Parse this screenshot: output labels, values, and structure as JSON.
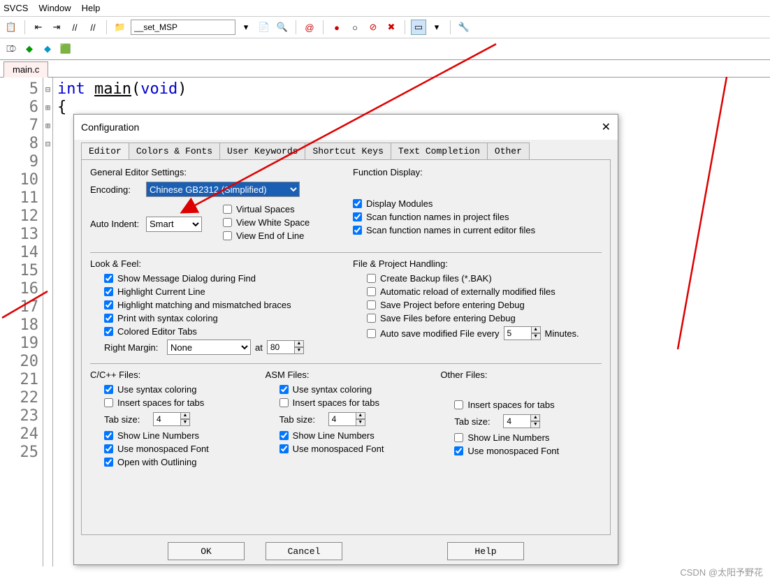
{
  "menu": [
    "SVCS",
    "Window",
    "Help"
  ],
  "toolbar_input": "__set_MSP",
  "file_tab": "main.c",
  "code_line": {
    "kw1": "int",
    "fn": "main",
    "p1": "(",
    "kw2": "void",
    "p2": ")",
    "brace": "{"
  },
  "line_numbers": [
    "5",
    "6",
    "7",
    "8",
    "9",
    "10",
    "11",
    "12",
    "13",
    "14",
    "15",
    "16",
    "17",
    "18",
    "19",
    "20",
    "21",
    "22",
    "23",
    "24",
    "25"
  ],
  "fold_marks": [
    "",
    "⊟",
    "",
    "",
    "",
    "",
    "",
    "",
    "",
    "",
    "",
    "",
    "",
    "⊞",
    "⊞",
    "",
    "",
    "",
    "",
    "⊟",
    ""
  ],
  "dialog": {
    "title": "Configuration",
    "tabs": [
      "Editor",
      "Colors & Fonts",
      "User Keywords",
      "Shortcut Keys",
      "Text Completion",
      "Other"
    ],
    "general": {
      "title": "General Editor Settings:",
      "encoding_lbl": "Encoding:",
      "encoding_val": "Chinese GB2312 (Simplified)",
      "autoindent_lbl": "Auto Indent:",
      "autoindent_val": "Smart",
      "virtual_spaces": "Virtual Spaces",
      "view_ws": "View White Space",
      "view_eol": "View End of Line"
    },
    "func": {
      "title": "Function Display:",
      "disp_mod": "Display Modules",
      "scan_proj": "Scan function names in project files",
      "scan_cur": "Scan function names in current editor files"
    },
    "look": {
      "title": "Look & Feel:",
      "msg_dlg": "Show Message Dialog during Find",
      "hl_line": "Highlight Current Line",
      "hl_brace": "Highlight matching and mismatched braces",
      "print_syn": "Print with syntax coloring",
      "col_tabs": "Colored Editor Tabs",
      "rmargin_lbl": "Right Margin:",
      "rmargin_val": "None",
      "at_lbl": "at",
      "at_val": "80"
    },
    "fph": {
      "title": "File & Project Handling:",
      "bak": "Create Backup files (*.BAK)",
      "reload": "Automatic reload of externally modified files",
      "save_proj": "Save Project before entering Debug",
      "save_files": "Save Files before entering Debug",
      "autosave": "Auto save modified File every",
      "autosave_val": "5",
      "minutes": "Minutes."
    },
    "ccpp": {
      "title": "C/C++ Files:",
      "syn": "Use syntax coloring",
      "ins_sp": "Insert spaces for tabs",
      "tab_lbl": "Tab size:",
      "tab_val": "4",
      "show_ln": "Show Line Numbers",
      "mono": "Use monospaced Font",
      "outline": "Open with Outlining"
    },
    "asm": {
      "title": "ASM Files:",
      "syn": "Use syntax coloring",
      "ins_sp": "Insert spaces for tabs",
      "tab_lbl": "Tab size:",
      "tab_val": "4",
      "show_ln": "Show Line Numbers",
      "mono": "Use monospaced Font"
    },
    "other": {
      "title": "Other Files:",
      "ins_sp": "Insert spaces for tabs",
      "tab_lbl": "Tab size:",
      "tab_val": "4",
      "show_ln": "Show Line Numbers",
      "mono": "Use monospaced Font"
    },
    "buttons": {
      "ok": "OK",
      "cancel": "Cancel",
      "help": "Help"
    }
  },
  "watermark": "CSDN @太阳予野花"
}
